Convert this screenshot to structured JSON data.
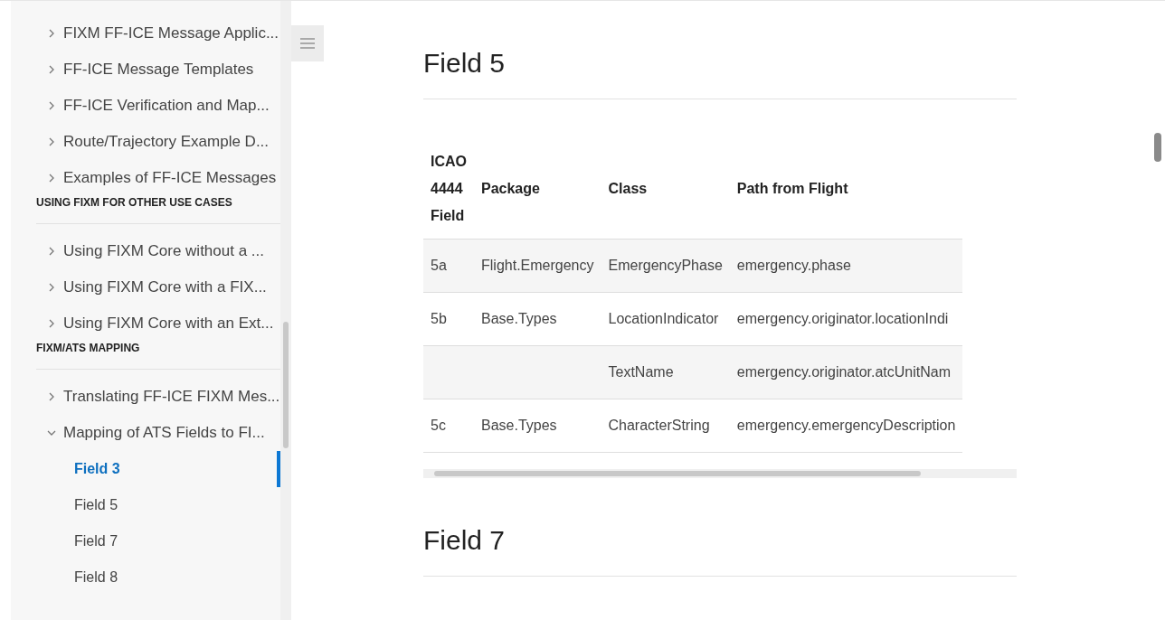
{
  "sidebar": {
    "sections": [
      {
        "items": [
          {
            "label": "FIXM FF-ICE Message Applic...",
            "expanded": false
          },
          {
            "label": "FF-ICE Message Templates",
            "expanded": false
          },
          {
            "label": "FF-ICE Verification and Map...",
            "expanded": false
          },
          {
            "label": "Route/Trajectory Example D...",
            "expanded": false
          },
          {
            "label": "Examples of FF-ICE Messages",
            "expanded": false
          }
        ]
      },
      {
        "heading": "USING FIXM FOR OTHER USE CASES",
        "items": [
          {
            "label": "Using FIXM Core without a ...",
            "expanded": false
          },
          {
            "label": "Using FIXM Core with a FIX...",
            "expanded": false
          },
          {
            "label": "Using FIXM Core with an Ext...",
            "expanded": false
          }
        ]
      },
      {
        "heading": "FIXM/ATS MAPPING",
        "items": [
          {
            "label": "Translating FF-ICE FIXM Mes...",
            "expanded": false
          },
          {
            "label": "Mapping of ATS Fields to FI...",
            "expanded": true,
            "children": [
              {
                "label": "Field 3",
                "selected": true
              },
              {
                "label": "Field 5",
                "selected": false
              },
              {
                "label": "Field 7",
                "selected": false
              },
              {
                "label": "Field 8",
                "selected": false
              }
            ]
          }
        ]
      }
    ]
  },
  "content": {
    "sections": [
      {
        "heading": "Field 5",
        "table": {
          "columns": [
            "ICAO 4444 Field",
            "Package",
            "Class",
            "Path from Flight"
          ],
          "rows": [
            [
              "5a",
              "Flight.Emergency",
              "EmergencyPhase",
              "emergency.phase"
            ],
            [
              "5b",
              "Base.Types",
              "LocationIndicator",
              "emergency.originator.locationIndi"
            ],
            [
              "",
              "",
              "TextName",
              "emergency.originator.atcUnitNam"
            ],
            [
              "5c",
              "Base.Types",
              "CharacterString",
              "emergency.emergencyDescription"
            ]
          ]
        }
      },
      {
        "heading": "Field 7"
      }
    ]
  }
}
